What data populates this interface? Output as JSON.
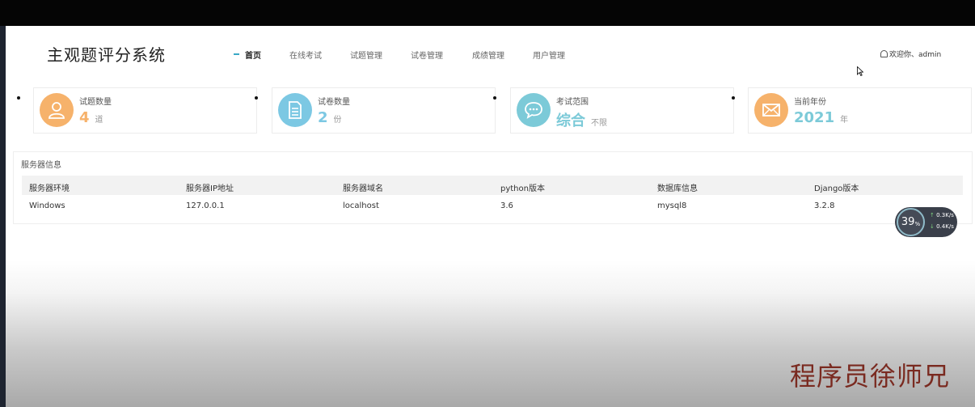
{
  "app": {
    "logo": "主观题评分系统"
  },
  "nav": {
    "items": [
      {
        "label": "首页",
        "active": true
      },
      {
        "label": "在线考试",
        "active": false
      },
      {
        "label": "试题管理",
        "active": false
      },
      {
        "label": "试卷管理",
        "active": false
      },
      {
        "label": "成绩管理",
        "active": false
      },
      {
        "label": "用户管理",
        "active": false
      }
    ]
  },
  "header": {
    "welcome": "欢迎你、admin"
  },
  "cards": [
    {
      "label": "试题数量",
      "value": "4",
      "unit": "道",
      "icon": "user-icon",
      "color": "#f6b26b"
    },
    {
      "label": "试卷数量",
      "value": "2",
      "unit": "份",
      "icon": "document-icon",
      "color": "#7cc8e3"
    },
    {
      "label": "考试范围",
      "value": "综合",
      "unit": "不限",
      "icon": "chat-bubble-icon",
      "color": "#7ccad8"
    },
    {
      "label": "当前年份",
      "value": "2021",
      "unit": "年",
      "icon": "envelope-icon",
      "color": "#f6b26b"
    }
  ],
  "server_info": {
    "title": "服务器信息",
    "columns": [
      "服务器环境",
      "服务器IP地址",
      "服务器域名",
      "python版本",
      "数据库信息",
      "Django版本"
    ],
    "row": [
      "Windows",
      "127.0.0.1",
      "localhost",
      "3.6",
      "mysql8",
      "3.2.8"
    ]
  },
  "net_widget": {
    "percent": "39",
    "percent_unit": "%",
    "up": "0.3",
    "down": "0.4",
    "speed_unit": "K/s"
  },
  "watermark": "程序员徐师兄"
}
